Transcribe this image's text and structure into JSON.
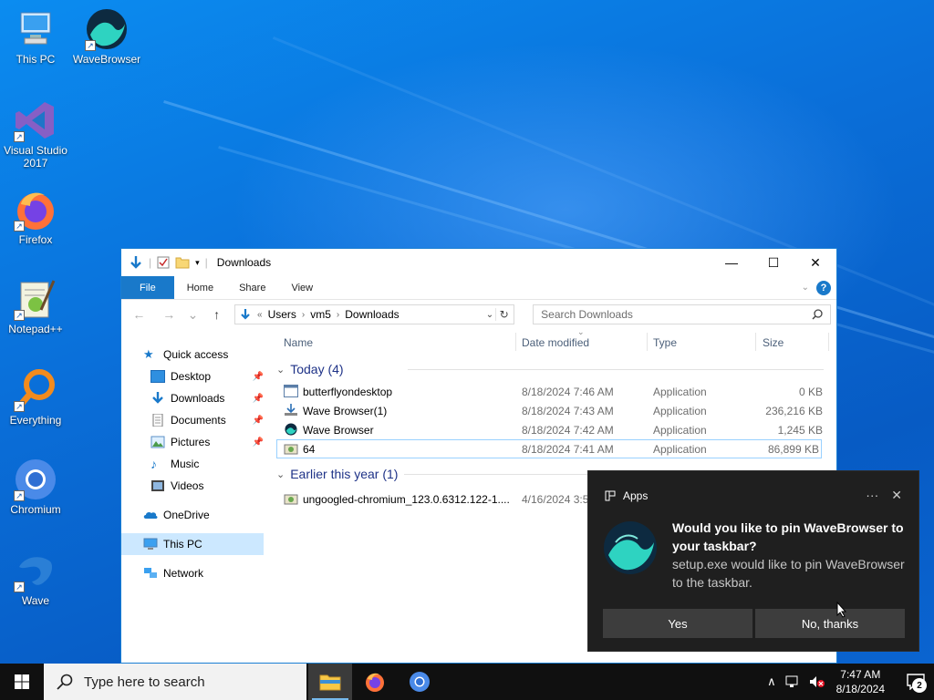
{
  "desktop": {
    "icons": [
      {
        "label": "This PC",
        "icon": "computer-icon"
      },
      {
        "label": "WaveBrowser",
        "icon": "wavebrowser-icon"
      },
      {
        "label": "Visual Studio 2017",
        "icon": "visual-studio-icon"
      },
      {
        "label": "Firefox",
        "icon": "firefox-icon"
      },
      {
        "label": "Notepad++",
        "icon": "notepad-plus-plus-icon"
      },
      {
        "label": "Everything",
        "icon": "everything-search-icon"
      },
      {
        "label": "Chromium",
        "icon": "chromium-icon"
      },
      {
        "label": "Wave",
        "icon": "wave-icon"
      }
    ]
  },
  "explorer": {
    "title": "Downloads",
    "tabs": {
      "file": "File",
      "home": "Home",
      "share": "Share",
      "view": "View"
    },
    "address": {
      "prefix": "«",
      "crumbs": [
        "Users",
        "vm5",
        "Downloads"
      ]
    },
    "search_placeholder": "Search Downloads",
    "nav": {
      "quick_access": "Quick access",
      "desktop": "Desktop",
      "downloads": "Downloads",
      "documents": "Documents",
      "pictures": "Pictures",
      "music": "Music",
      "videos": "Videos",
      "onedrive": "OneDrive",
      "this_pc": "This PC",
      "network": "Network"
    },
    "columns": {
      "name": "Name",
      "date": "Date modified",
      "type": "Type",
      "size": "Size"
    },
    "groups": [
      {
        "label": "Today (4)",
        "files": [
          {
            "name": "butterflyondesktop",
            "date": "8/18/2024 7:46 AM",
            "type": "Application",
            "size": "0 KB"
          },
          {
            "name": "Wave Browser(1)",
            "date": "8/18/2024 7:43 AM",
            "type": "Application",
            "size": "236,216 KB"
          },
          {
            "name": "Wave Browser",
            "date": "8/18/2024 7:42 AM",
            "type": "Application",
            "size": "1,245 KB"
          },
          {
            "name": "64",
            "date": "8/18/2024 7:41 AM",
            "type": "Application",
            "size": "86,899 KB"
          }
        ]
      },
      {
        "label": "Earlier this year (1)",
        "files": [
          {
            "name": "ungoogled-chromium_123.0.6312.122-1....",
            "date": "4/16/2024 3:53",
            "type": "",
            "size": ""
          }
        ]
      }
    ]
  },
  "toast": {
    "app": "Apps",
    "title": "Would you like to pin WaveBrowser to your taskbar?",
    "message": "setup.exe would like to pin WaveBrowser to the taskbar.",
    "yes": "Yes",
    "no": "No, thanks"
  },
  "taskbar": {
    "search_placeholder": "Type here to search",
    "time": "7:47 AM",
    "date": "8/18/2024",
    "notification_count": "2"
  }
}
